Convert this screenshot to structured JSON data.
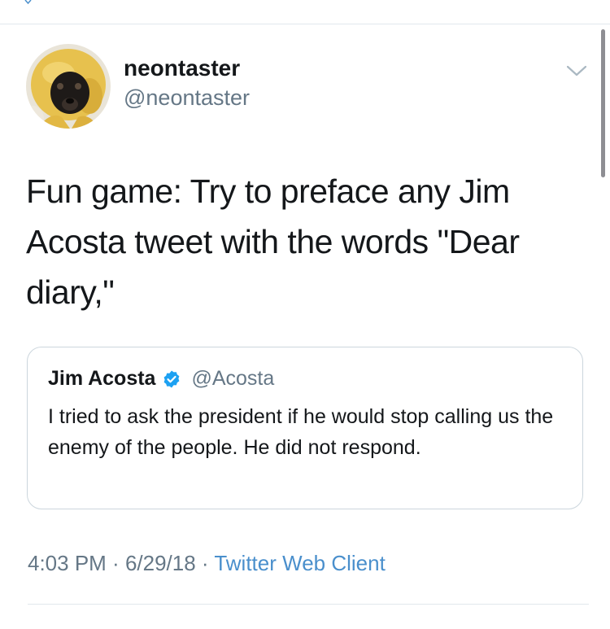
{
  "tweet": {
    "display_name": "neontaster",
    "handle": "@neontaster",
    "text": "Fun game: Try to preface any Jim Acosta tweet with the words \"Dear diary,\"",
    "avatar_icon": "dog-in-yellow-raincoat-avatar"
  },
  "quoted_tweet": {
    "display_name": "Jim Acosta",
    "verified_icon": "verified-badge-icon",
    "handle": "@Acosta",
    "text": "I tried to ask the president if he would stop calling us the enemy of the people. He did not respond."
  },
  "meta": {
    "time": "4:03 PM",
    "separator_1": " · ",
    "date": "6/29/18",
    "separator_2": " · ",
    "source": "Twitter Web Client"
  },
  "colors": {
    "text_primary": "#14171a",
    "text_secondary": "#657786",
    "link": "#4a8fcc",
    "verified": "#1da1f2",
    "border": "#ccd6dd"
  }
}
